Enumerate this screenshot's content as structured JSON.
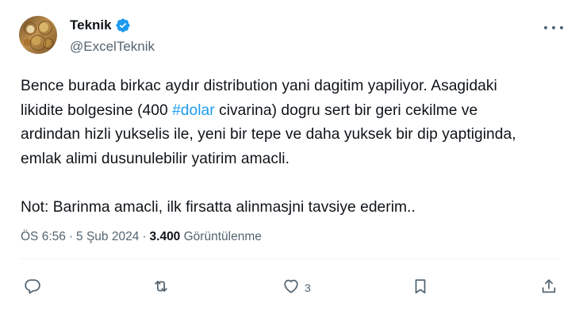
{
  "author": {
    "display_name": "Teknik",
    "handle": "@ExcelTeknik",
    "verified": true,
    "verified_color": "#1d9bf0"
  },
  "tweet": {
    "line1": "Bence burada birkac aydır distribution yani dagitim yapiliyor. Asagidaki",
    "line2_pre": "likidite bolgesine (400 ",
    "line2_hashtag": "#dolar",
    "line2_post": " civarina) dogru sert bir geri cekilme ve",
    "line3": "ardindan hizli yukselis ile, yeni bir tepe ve daha yuksek bir dip yaptiginda,",
    "line4": "emlak alimi dusunulebilir yatirim amacli.",
    "line5": "Not: Barinma amacli, ilk firsatta alinmasjni tavsiye ederim.."
  },
  "meta": {
    "time": "ÖS 6:56",
    "date": "5 Şub 2024",
    "separator": "·",
    "views_count": "3.400",
    "views_label": "Görüntülenme"
  },
  "actions": {
    "reply_icon": "reply-icon",
    "retweet_icon": "retweet-icon",
    "like_icon": "heart-icon",
    "like_count": "3",
    "bookmark_icon": "bookmark-icon",
    "share_icon": "share-icon"
  },
  "colors": {
    "text": "#0f1419",
    "secondary": "#536471",
    "accent": "#1d9bf0"
  }
}
